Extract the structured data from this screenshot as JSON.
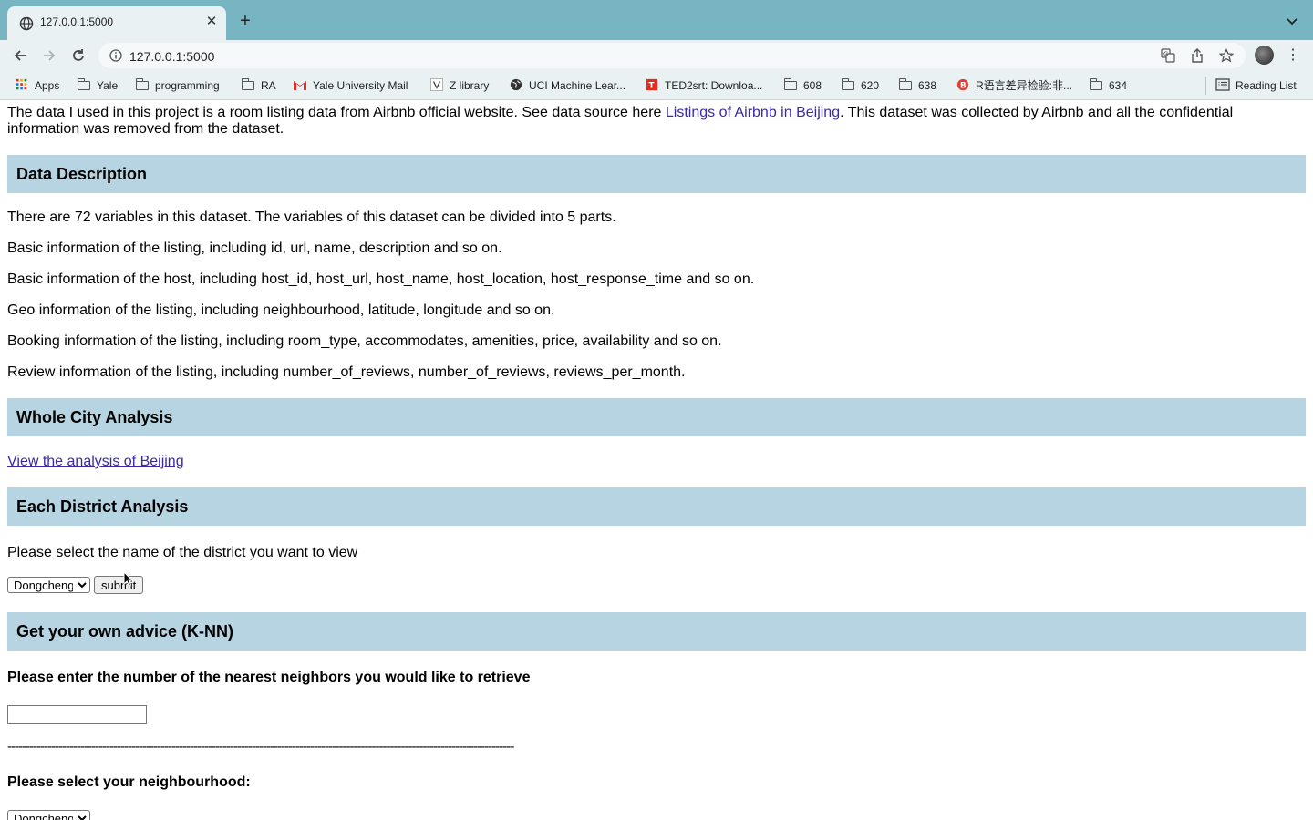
{
  "browser": {
    "tab_title": "127.0.0.1:5000",
    "url": "127.0.0.1:5000",
    "bookmarks": [
      {
        "label": "Apps"
      },
      {
        "label": "Yale"
      },
      {
        "label": "programming"
      },
      {
        "label": "RA"
      },
      {
        "label": "Yale University Mail"
      },
      {
        "label": "Z library"
      },
      {
        "label": "UCI Machine Lear..."
      },
      {
        "label": "TED2srt: Downloa..."
      },
      {
        "label": "608"
      },
      {
        "label": "620"
      },
      {
        "label": "638"
      },
      {
        "label": "R语言差异检验:非..."
      },
      {
        "label": "634"
      }
    ],
    "reading_list": "Reading List"
  },
  "intro": {
    "before_link": "The data I used in this project is a room listing data from Airbnb official website. See data source here ",
    "link": "Listings of Airbnb in Beijing",
    "after_link": ". This dataset was collected by Airbnb and all the confidential information was removed from the dataset."
  },
  "data_description": {
    "heading": "Data Description",
    "lines": [
      "There are 72 variables in this dataset. The variables of this dataset can be divided into 5 parts.",
      "Basic information of the listing, including id, url, name, description and so on.",
      "Basic information of the host, including host_id, host_url, host_name, host_location, host_response_time and so on.",
      "Geo information of the listing, including neighbourhood, latitude, longitude and so on.",
      "Booking information of the listing, including room_type, accommodates, amenities, price, availability and so on.",
      "Review information of the listing, including number_of_reviews, number_of_reviews, reviews_per_month."
    ]
  },
  "whole_city": {
    "heading": "Whole City Analysis",
    "link": "View the analysis of Beijing"
  },
  "district": {
    "heading": "Each District Analysis",
    "prompt": "Please select the name of the district you want to view",
    "selected": "Dongcheng",
    "submit_label": "submit"
  },
  "knn": {
    "heading": "Get your own advice (K-NN)",
    "neighbors_prompt": "Please enter the number of the nearest neighbors you would like to retrieve",
    "neighbors_value": "",
    "separator": "-------------------------------------------------------------------------------------------------------------------------------------------",
    "neighbourhood_prompt": "Please select your neighbourhood:",
    "neighbourhood_selected": "Dongcheng"
  }
}
